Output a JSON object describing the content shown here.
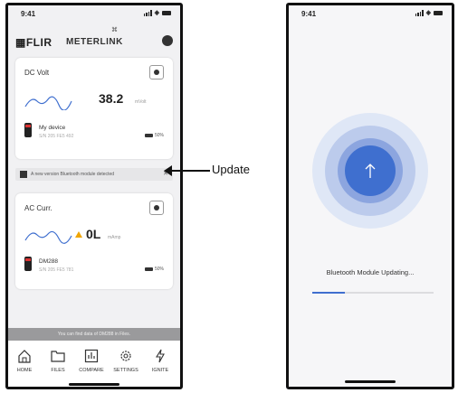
{
  "left_screen": {
    "status_time": "9:41",
    "brand": "FLIR",
    "app_name": "METERLINK",
    "dc_card": {
      "title": "DC Volt",
      "value": "38.2",
      "unit": "mVolt",
      "device_name": "My device",
      "device_sn": "S/N 205 FE5 492",
      "battery": "50%"
    },
    "notice": {
      "text": "A new version Bluetooth module detected",
      "close": "✕"
    },
    "ac_card": {
      "title": "AC Curr.",
      "value": "0L",
      "unit": "mAmp",
      "device_name": "DM288",
      "device_sn": "S/N 205 FE5 781",
      "battery": "50%"
    },
    "files_hint": "You can find data of DM288 in Files.",
    "tabs": [
      {
        "label": "HOME",
        "icon": "home-icon"
      },
      {
        "label": "FILES",
        "icon": "folder-icon"
      },
      {
        "label": "COMPARE",
        "icon": "compare-icon"
      },
      {
        "label": "SETTINGS",
        "icon": "gear-icon"
      },
      {
        "label": "IGNITE",
        "icon": "ignite-icon"
      }
    ]
  },
  "annotation": {
    "label": "Update"
  },
  "right_screen": {
    "status_time": "9:41",
    "status_text": "Bluetooth Module Updating...",
    "progress": 0.27,
    "accent": "#3f6fcf"
  }
}
